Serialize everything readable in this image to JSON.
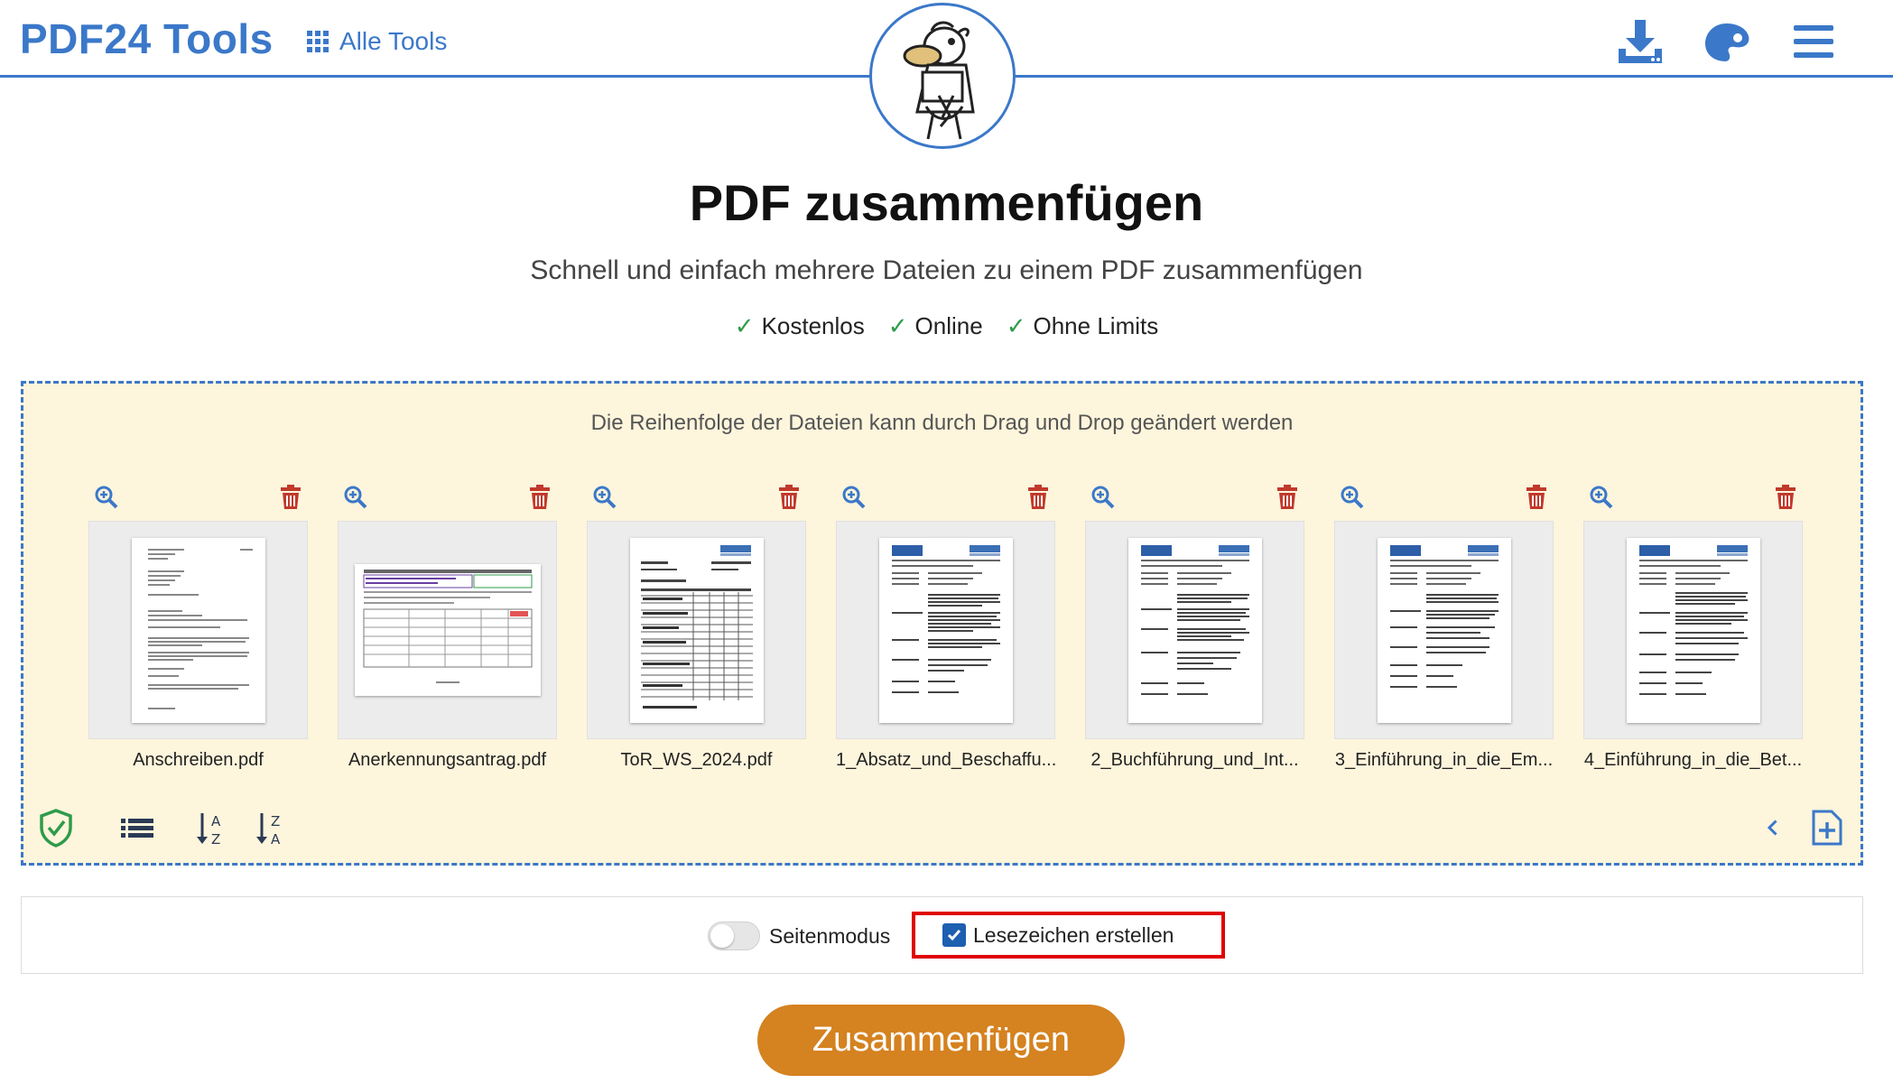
{
  "header": {
    "brand": "PDF24 Tools",
    "all_tools_label": "Alle Tools",
    "icons": [
      "grid-icon",
      "download-app-icon",
      "palette-icon",
      "hamburger-menu-icon"
    ]
  },
  "hero": {
    "title": "PDF zusammenfügen",
    "subtitle": "Schnell und einfach mehrere Dateien zu einem PDF zusammenfügen",
    "features": [
      "Kostenlos",
      "Online",
      "Ohne Limits"
    ],
    "check_glyph": "✓"
  },
  "dropzone": {
    "hint": "Die Reihenfolge der Dateien kann durch Drag und Drop geändert werden",
    "files": [
      {
        "name": "Anschreiben.pdf"
      },
      {
        "name": "Anerkennungsantrag.pdf"
      },
      {
        "name": "ToR_WS_2024.pdf"
      },
      {
        "name": "1_Absatz_und_Beschaffu..."
      },
      {
        "name": "2_Buchführung_und_Int..."
      },
      {
        "name": "3_Einführung_in_die_Em..."
      },
      {
        "name": "4_Einführung_in_die_Bet..."
      }
    ]
  },
  "options": {
    "page_mode_label": "Seitenmodus",
    "page_mode_on": false,
    "bookmarks_label": "Lesezeichen erstellen",
    "bookmarks_checked": true
  },
  "actions": {
    "merge_label": "Zusammenfügen"
  },
  "colors": {
    "brand_blue": "#3b78c9",
    "dropzone_bg": "#fdf5dc",
    "merge_orange": "#d58220",
    "trash_red": "#c0392b",
    "check_green": "#2e9b4a",
    "highlight_red": "#e00000"
  }
}
